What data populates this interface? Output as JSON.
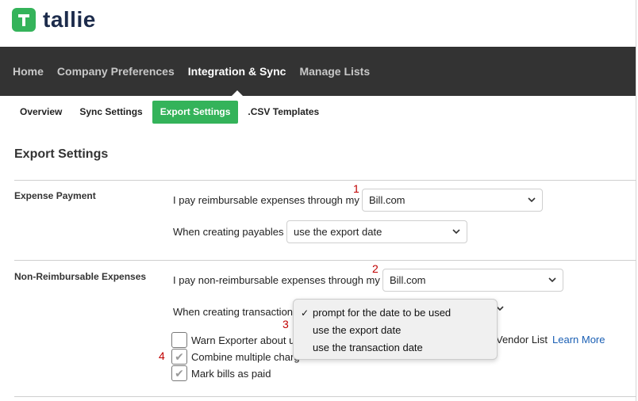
{
  "app": {
    "logo_letter": "T",
    "logo_text": "tallie",
    "brand_color": "#34b35a",
    "nav_bg": "#333333"
  },
  "main_nav": {
    "items": [
      {
        "label": "Home",
        "active": false
      },
      {
        "label": "Company Preferences",
        "active": false
      },
      {
        "label": "Integration & Sync",
        "active": true
      },
      {
        "label": "Manage Lists",
        "active": false
      }
    ]
  },
  "sub_nav": {
    "tabs": [
      {
        "label": "Overview",
        "active": false
      },
      {
        "label": "Sync Settings",
        "active": false
      },
      {
        "label": "Export Settings",
        "active": true
      },
      {
        "label": ".CSV Templates",
        "active": false
      }
    ]
  },
  "page": {
    "title": "Export Settings"
  },
  "expense_payment": {
    "section_label": "Expense Payment",
    "pay_label": "I pay reimbursable expenses through my",
    "pay_value": "Bill.com",
    "payables_label": "When creating payables",
    "payables_value": "use the export date"
  },
  "non_reimbursable": {
    "section_label": "Non-Reimbursable Expenses",
    "pay_label": "I pay non-reimbursable expenses through my",
    "pay_value": "Bill.com",
    "transactions_label": "When creating transactions",
    "dropdown_options": [
      {
        "label": "prompt for the date to be used",
        "checked": true
      },
      {
        "label": "use the export date",
        "checked": false
      },
      {
        "label": "use the transaction date",
        "checked": false
      }
    ],
    "checkboxes": [
      {
        "label": "Warn Exporter about u",
        "checked": false
      },
      {
        "label": "Combine multiple charg",
        "checked": true
      },
      {
        "label": "Mark bills as paid",
        "checked": true
      }
    ],
    "vendor_list_text": "Vendor List",
    "learn_more": "Learn More"
  },
  "annotations": {
    "one": "1",
    "two": "2",
    "three": "3",
    "four": "4"
  }
}
